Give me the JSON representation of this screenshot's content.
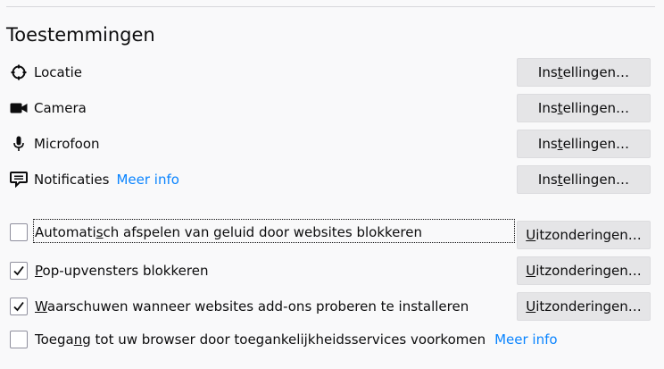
{
  "section": {
    "title": "Toestemmingen"
  },
  "permissions": [
    {
      "label": "Locatie",
      "icon": "location-icon",
      "button_pre": "Ins",
      "button_acc": "t",
      "button_post": "ellingen…"
    },
    {
      "label": "Camera",
      "icon": "camera-icon",
      "button_pre": "Ins",
      "button_acc": "t",
      "button_post": "ellingen…"
    },
    {
      "label": "Microfoon",
      "icon": "microphone-icon",
      "button_pre": "Ins",
      "button_acc": "t",
      "button_post": "ellingen…"
    },
    {
      "label": "Notificaties",
      "icon": "notification-icon",
      "learn_more": "Meer info",
      "button_pre": "Ins",
      "button_acc": "t",
      "button_post": "ellingen…"
    }
  ],
  "checkboxes": [
    {
      "checked": false,
      "focused": true,
      "label_pre": "Automati",
      "label_acc": "s",
      "label_post": "ch afspelen van geluid door websites blokkeren",
      "button_acc": "U",
      "button_post": "itzonderingen…"
    },
    {
      "checked": true,
      "label_pre": "",
      "label_acc": "P",
      "label_post": "op-upvensters blokkeren",
      "button_acc": "U",
      "button_post": "itzonderingen…"
    },
    {
      "checked": true,
      "label_pre": "",
      "label_acc": "W",
      "label_post": "aarschuwen wanneer websites add-ons proberen te installeren",
      "button_acc": "U",
      "button_post": "itzonderingen…"
    },
    {
      "checked": false,
      "label_pre": "Toega",
      "label_acc": "n",
      "label_post": "g tot uw browser door toegankelijkheidsservices voorkomen",
      "learn_more": "Meer info"
    }
  ],
  "colors": {
    "link": "#0a84ff",
    "button_bg": "#e5e5e7",
    "page_bg": "#f9f9fa"
  }
}
